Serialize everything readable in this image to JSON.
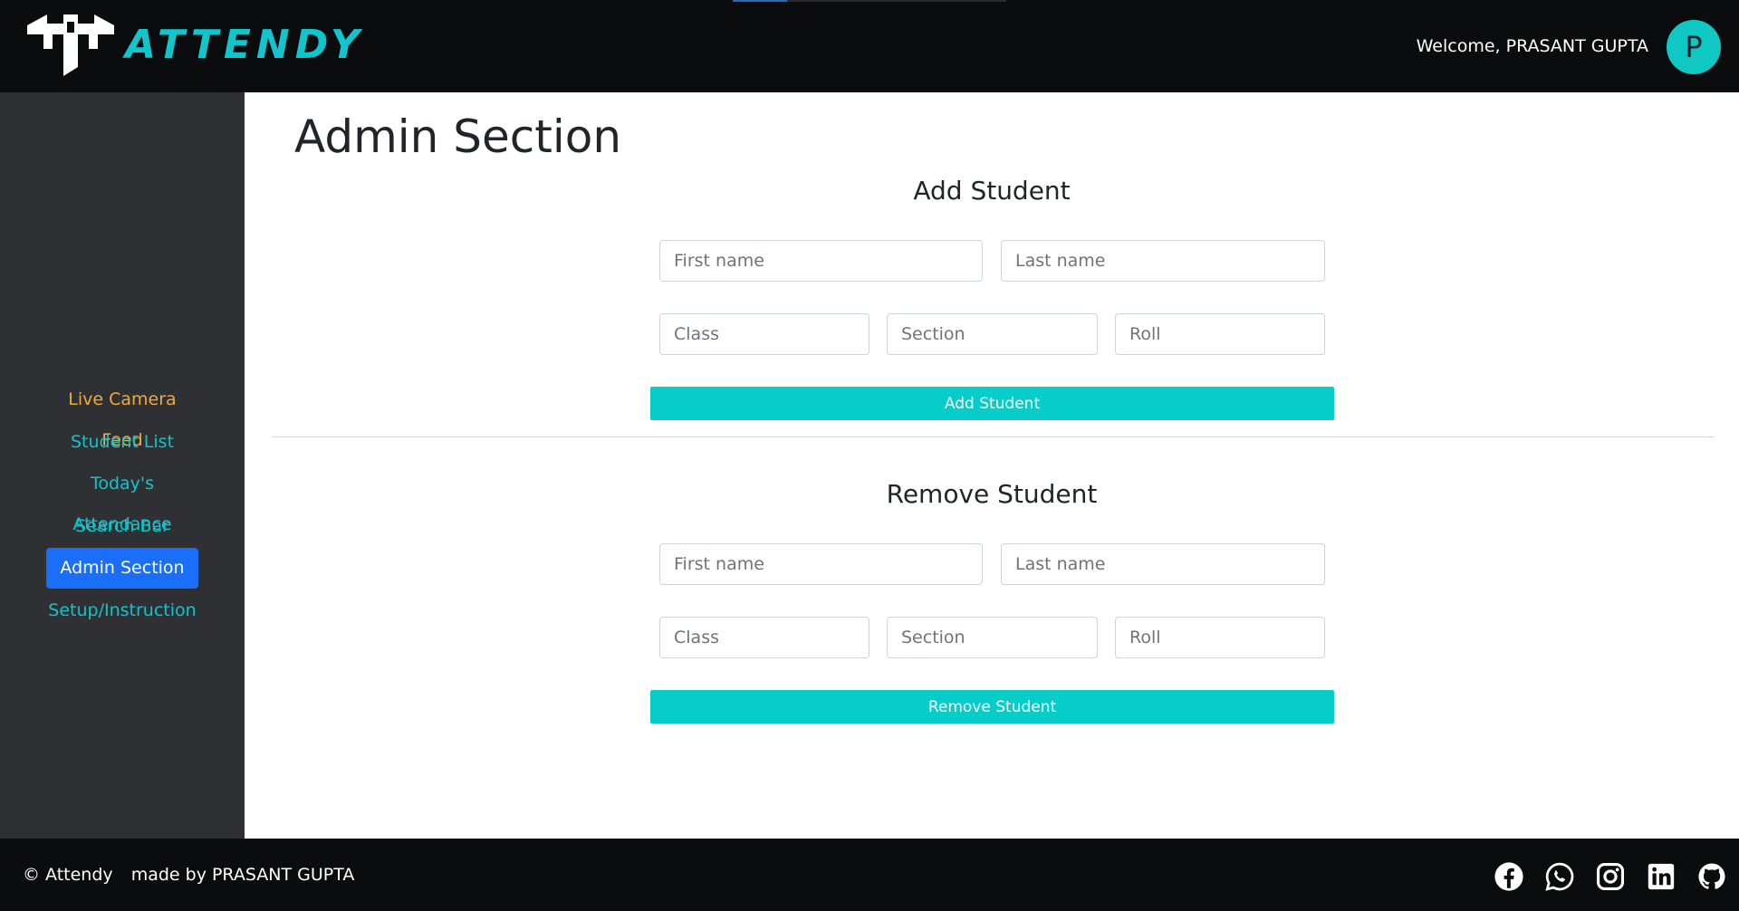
{
  "header": {
    "brand": "ATTENDY",
    "welcome": "Welcome, PRASANT GUPTA",
    "avatar_initial": "P"
  },
  "sidebar": {
    "items": [
      {
        "label": "Live Camera Feed"
      },
      {
        "label": "Student List"
      },
      {
        "label": "Today's Attendance"
      },
      {
        "label": "Search Bar"
      },
      {
        "label": "Admin Section"
      },
      {
        "label": "Setup/Instruction"
      }
    ],
    "active": "Admin Section"
  },
  "main": {
    "title": "Admin Section",
    "add": {
      "heading": "Add Student",
      "first_name_placeholder": "First name",
      "last_name_placeholder": "Last name",
      "class_placeholder": "Class",
      "section_placeholder": "Section",
      "roll_placeholder": "Roll",
      "button": "Add Student"
    },
    "remove": {
      "heading": "Remove Student",
      "first_name_placeholder": "First name",
      "last_name_placeholder": "Last name",
      "class_placeholder": "Class",
      "section_placeholder": "Section",
      "roll_placeholder": "Roll",
      "button": "Remove Student"
    }
  },
  "footer": {
    "copyright": "© Attendy",
    "credit": "made by PRASANT GUPTA",
    "socials": [
      "facebook-icon",
      "whatsapp-icon",
      "instagram-icon",
      "linkedin-icon",
      "github-icon"
    ]
  },
  "colors": {
    "accent": "#06cdc9",
    "active_nav": "#1a6ef7",
    "live_nav": "#f2a93b",
    "dark_bg": "#0b0c0e",
    "sidebar_bg": "#2f3033"
  }
}
